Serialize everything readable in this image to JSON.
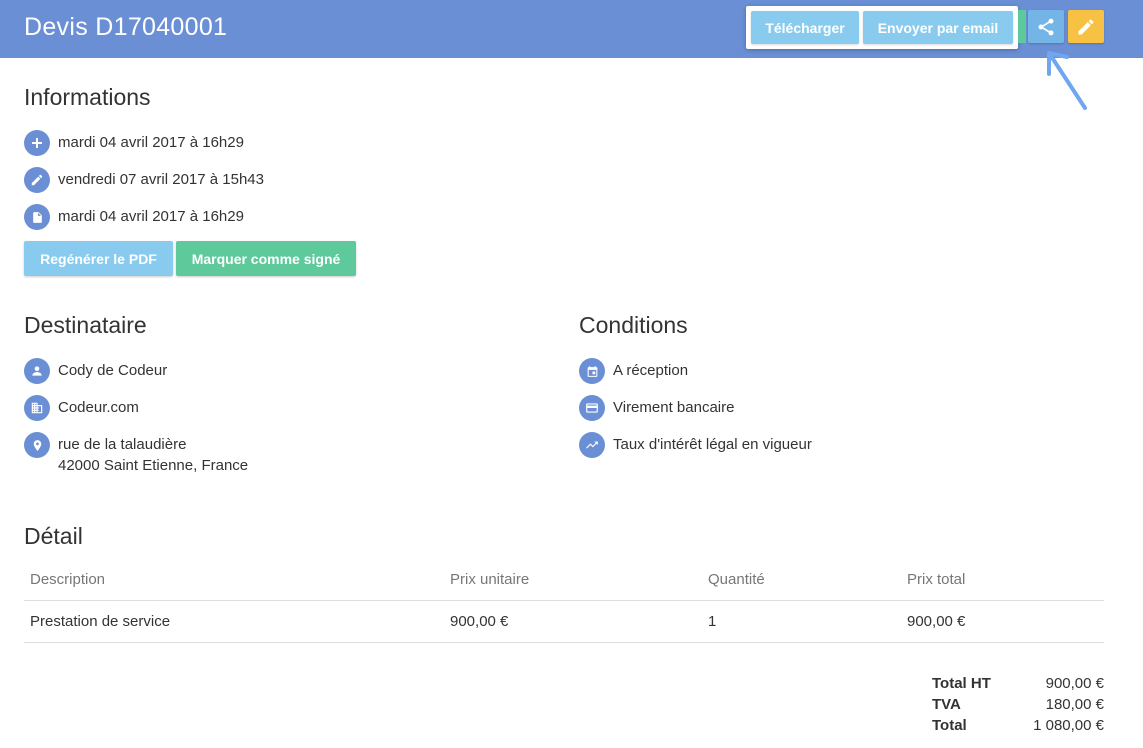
{
  "header": {
    "title": "Devis D17040001",
    "download_label": "Télécharger",
    "email_label": "Envoyer par email",
    "share_icon": "share-icon",
    "edit_icon": "pencil-icon",
    "colors": {
      "bar": "#6a8fd4",
      "share": "#73b5e6",
      "edit": "#f7c244",
      "popover_button": "#88cbef"
    }
  },
  "informations": {
    "title": "Informations",
    "rows": [
      {
        "icon": "plus-icon",
        "text": "mardi 04 avril 2017 à 16h29"
      },
      {
        "icon": "pencil-icon",
        "text": "vendredi 07 avril 2017 à 15h43"
      },
      {
        "icon": "file-icon",
        "text": "mardi 04 avril 2017 à 16h29"
      }
    ],
    "regenerate_label": "Regénérer le PDF",
    "mark_signed_label": "Marquer comme signé"
  },
  "destinataire": {
    "title": "Destinataire",
    "name": "Cody de Codeur",
    "company": "Codeur.com",
    "address_line1": "rue de la talaudière",
    "address_line2": "42000 Saint Etienne, France"
  },
  "conditions": {
    "title": "Conditions",
    "payment_term": "A réception",
    "payment_method": "Virement bancaire",
    "late_interest": "Taux d'intérêt légal en vigueur"
  },
  "detail": {
    "title": "Détail",
    "columns": [
      "Description",
      "Prix unitaire",
      "Quantité",
      "Prix total"
    ],
    "rows": [
      [
        "Prestation de service",
        "900,00 €",
        "1",
        "900,00 €"
      ]
    ]
  },
  "totals": {
    "ht_label": "Total HT",
    "ht_value": "900,00 €",
    "tva_label": "TVA",
    "tva_value": "180,00 €",
    "total_label": "Total",
    "total_value": "1 080,00 €"
  }
}
